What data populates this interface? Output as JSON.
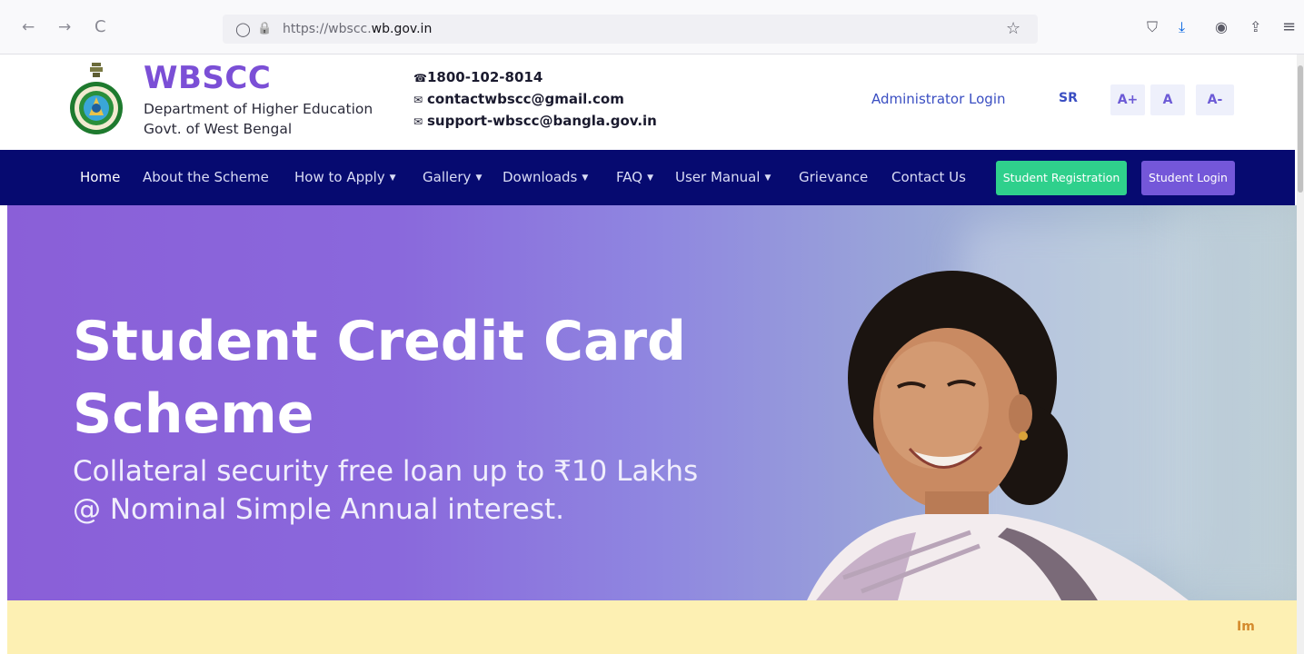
{
  "browser": {
    "back_icon": "←",
    "forward_icon": "→",
    "reload_icon": "C",
    "shield_icon": "◯",
    "lock_icon": "🔒",
    "url_prefix": "https://wbscc.",
    "url_domain": "wb.gov.in",
    "bookmark_icon": "☆",
    "pocket_icon": "⛉",
    "download_icon": "⤓",
    "account_icon": "◉",
    "extensions_icon": "⇪",
    "menu_icon": "≡"
  },
  "header": {
    "brand": "WBSCC",
    "dept_line1": "Department of Higher Education",
    "dept_line2": "Govt. of West Bengal",
    "phone": "1800-102-8014",
    "email1": "contactwbscc@gmail.com",
    "email2": "support-wbscc@bangla.gov.in",
    "admin_login": "Administrator Login",
    "sr": "SR",
    "font_increase": "A+",
    "font_normal": "A",
    "font_decrease": "A-"
  },
  "nav": {
    "items": [
      {
        "label": "Home",
        "caret": ""
      },
      {
        "label": "About the Scheme",
        "caret": ""
      },
      {
        "label": "How to Apply",
        "caret": "▼"
      },
      {
        "label": "Gallery",
        "caret": "▼"
      },
      {
        "label": "Downloads",
        "caret": "▼"
      },
      {
        "label": "FAQ",
        "caret": "▼"
      },
      {
        "label": "User Manual",
        "caret": "▼"
      },
      {
        "label": "Grievance",
        "caret": ""
      },
      {
        "label": "Contact Us",
        "caret": ""
      }
    ],
    "register_button": "Student Registration",
    "login_button": "Student Login"
  },
  "hero": {
    "title_line1": "Student Credit Card",
    "title_line2": "Scheme",
    "subtitle_line1": "Collateral security free loan up to ₹10 Lakhs",
    "subtitle_line2": "@ Nominal Simple Annual interest."
  },
  "notice": {
    "text": "Im"
  },
  "colors": {
    "brand": "#7b4fd6",
    "navbar": "#060a70",
    "register": "#2fd08c",
    "login": "#7457d9",
    "notice_bg": "#fdf0b3"
  }
}
